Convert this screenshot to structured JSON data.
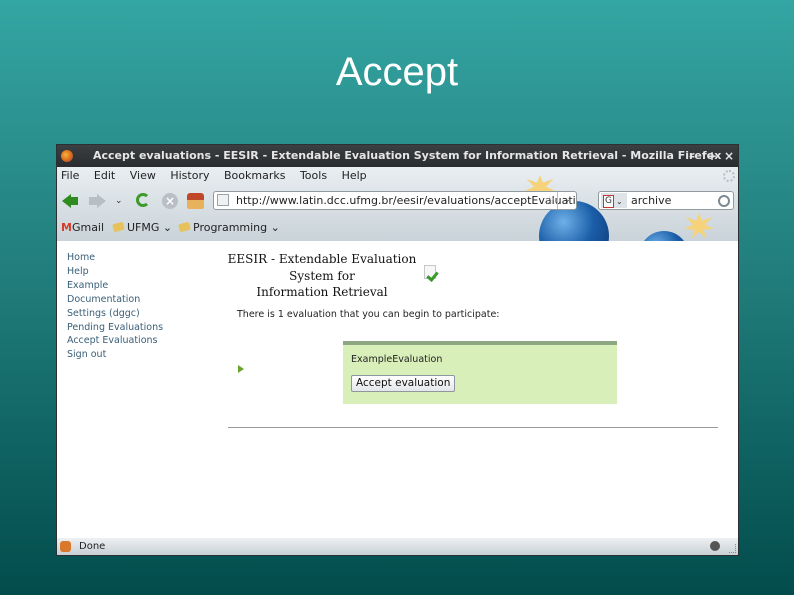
{
  "slide": {
    "title": "Accept"
  },
  "window": {
    "title": "Accept evaluations - EESIR - Extendable Evaluation System for Information Retrieval - Mozilla Firefox",
    "controls": {
      "minimize": "–",
      "maximize": "+",
      "close": "×"
    }
  },
  "menubar": {
    "items": [
      {
        "label": "File",
        "accel": "F"
      },
      {
        "label": "Edit",
        "accel": "E"
      },
      {
        "label": "View",
        "accel": "V"
      },
      {
        "label": "History",
        "accel": "s"
      },
      {
        "label": "Bookmarks",
        "accel": "B"
      },
      {
        "label": "Tools",
        "accel": "T"
      },
      {
        "label": "Help",
        "accel": "H"
      }
    ]
  },
  "navbar": {
    "url": "http://www.latin.dcc.ufmg.br/eesir/evaluations/acceptEvaluation.",
    "search_value": "archive",
    "dropdown_glyph": "⌄"
  },
  "bookmarks": {
    "items": [
      {
        "label": "Gmail",
        "icon": "gmail-icon"
      },
      {
        "label": "UFMG ⌄",
        "icon": "folder-icon"
      },
      {
        "label": "Programming ⌄",
        "icon": "folder-icon"
      }
    ]
  },
  "page": {
    "sidenav": [
      "Home",
      "Help",
      "Example",
      "Documentation",
      "Settings (dggc)",
      "Pending Evaluations",
      "Accept Evaluations",
      "Sign out"
    ],
    "app_title_lines": [
      "EESIR - Extendable Evaluation",
      "System for",
      "Information Retrieval"
    ],
    "intro": "There is 1 evaluation that you can begin to participate:",
    "evaluation": {
      "name": "ExampleEvaluation",
      "accept_label": "Accept evaluation"
    }
  },
  "status": {
    "text": "Done"
  },
  "colors": {
    "accent_link": "#3a5f78",
    "eval_box_bg": "#d9efb9",
    "eval_box_border": "#8ea783",
    "bg_top": "#34a6a3",
    "bg_bottom": "#034c4c"
  }
}
